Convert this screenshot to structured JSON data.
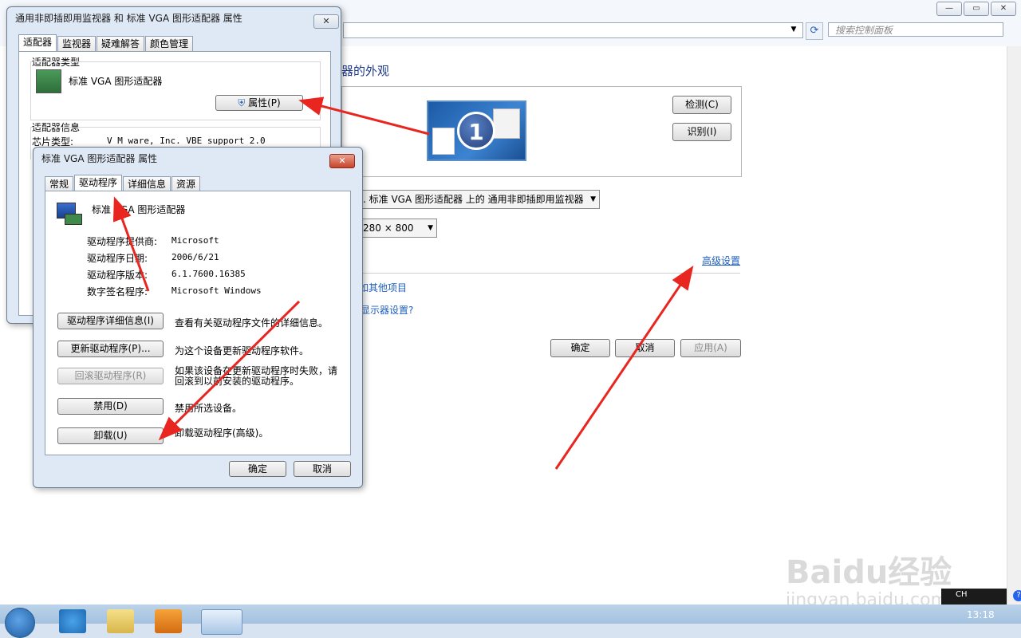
{
  "bg_window": {
    "search_placeholder": "搜索控制面板",
    "heading": "器的外观",
    "detect_label": "检测(C)",
    "identify_label": "识别(I)",
    "monitor_number": "1",
    "display_select": ". 标准 VGA 图形适配器 上的 通用非即插即用监视器",
    "resolution_select": "280 × 800",
    "advanced_link": "高级设置",
    "link_other": "如其他项目",
    "link_display": "显示器设置?",
    "ok_label": "确定",
    "cancel_label": "取消",
    "apply_label": "应用(A)"
  },
  "dialog1": {
    "title": "通用非即插即用监视器 和 标准 VGA 图形适配器 属性",
    "close": "✕",
    "tabs": [
      "适配器",
      "监视器",
      "疑难解答",
      "颜色管理"
    ],
    "adapter_type_group": "适配器类型",
    "adapter_name": "标准 VGA 图形适配器",
    "properties_button": "属性(P)",
    "adapter_info_group": "适配器信息",
    "chip_type_label": "芯片类型:",
    "chip_type_value": "V M ware, Inc. VBE support 2.0"
  },
  "dialog2": {
    "title": "标准 VGA 图形适配器 属性",
    "close": "✕",
    "tabs": [
      "常规",
      "驱动程序",
      "详细信息",
      "资源"
    ],
    "device_name": "标准 VGA 图形适配器",
    "info": [
      {
        "label": "驱动程序提供商:",
        "value": "Microsoft"
      },
      {
        "label": "驱动程序日期:",
        "value": "2006/6/21"
      },
      {
        "label": "驱动程序版本:",
        "value": "6.1.7600.16385"
      },
      {
        "label": "数字签名程序:",
        "value": "Microsoft Windows"
      }
    ],
    "actions": [
      {
        "button": "驱动程序详细信息(I)",
        "desc": "查看有关驱动程序文件的详细信息。"
      },
      {
        "button": "更新驱动程序(P)...",
        "desc": "为这个设备更新驱动程序软件。"
      },
      {
        "button": "回滚驱动程序(R)",
        "desc": "如果该设备在更新驱动程序时失败，请回滚到以前安装的驱动程序。"
      },
      {
        "button": "禁用(D)",
        "desc": "禁用所选设备。"
      },
      {
        "button": "卸载(U)",
        "desc": "卸载驱动程序(高级)。"
      }
    ],
    "ok_label": "确定",
    "cancel_label": "取消"
  },
  "taskbar": {
    "clock": "13:18",
    "lang": "CH"
  },
  "watermark": {
    "brand": "Baidu经验",
    "url": "jingyan.baidu.com"
  },
  "colors": {
    "arrow": "#e8261f",
    "link": "#1f5fbf",
    "dialog_bg": "#dfe9f5"
  }
}
